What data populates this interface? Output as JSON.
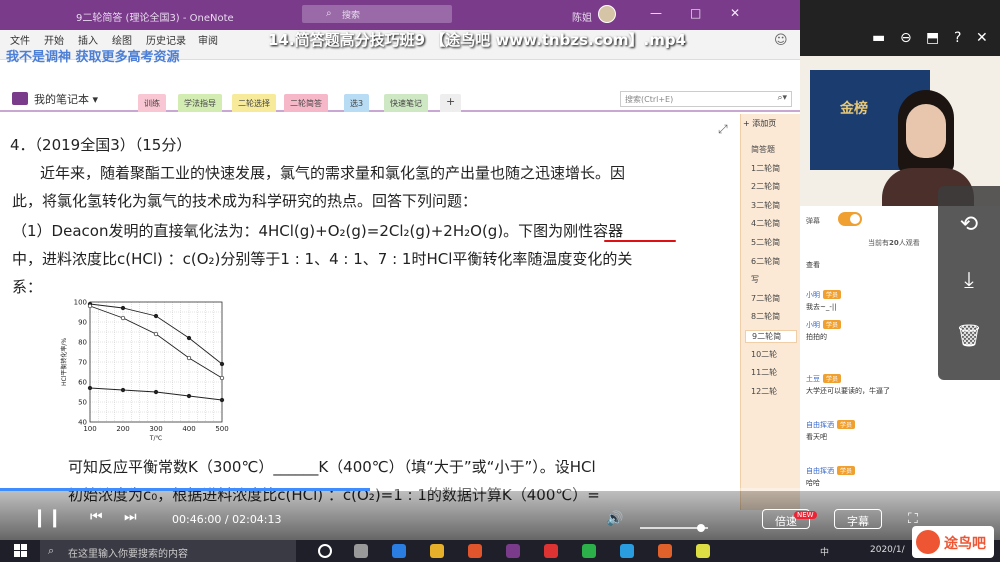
{
  "window": {
    "title": "9二轮简答 (理论全国3) - OneNote",
    "search_placeholder": "搜索",
    "user_name": "陈姐",
    "video_title": "14.简答题高分技巧班9 【途鸟吧 www.tnbzs.com】.mp4"
  },
  "ribbon": {
    "tabs": [
      "文件",
      "开始",
      "插入",
      "绘图",
      "历史记录",
      "审阅"
    ],
    "watermark": "我不是调神 获取更多高考资源"
  },
  "notebook": {
    "name": "我的笔记本",
    "sections": [
      {
        "label": "训练",
        "color": "#f9c7d4"
      },
      {
        "label": "学法指导",
        "color": "#d3ecb2"
      },
      {
        "label": "二轮选择",
        "color": "#f7ea9b"
      },
      {
        "label": "二轮简答",
        "color": "#f6b7c9"
      },
      {
        "label": "选3",
        "color": "#b7dcf4"
      },
      {
        "label": "快速笔记",
        "color": "#cfe8c4"
      }
    ],
    "add_section": "+",
    "search_placeholder": "搜索(Ctrl+E)"
  },
  "question": {
    "line1": "4．（2019全国3）（15分）",
    "line2": "近年来，随着聚酯工业的快速发展，氯气的需求量和氯化氢的产出量也随之迅速增长。因",
    "line3": "此，将氯化氢转化为氯气的技术成为科学研究的热点。回答下列问题：",
    "line4": "（1）Deacon发明的直接氧化法为：4HCl(g)+O₂(g)=2Cl₂(g)+2H₂O(g)。下图为刚性容器",
    "line5": "中，进料浓度比c(HCl) ：c(O₂)分别等于1 : 1、4 : 1、7 : 1时HCl平衡转化率随温度变化的关",
    "line6": "系：",
    "line7": "可知反应平衡常数K（300℃）______K（400℃）（填“大于”或“小于”）。设HCl",
    "line8": "初始浓度为c₀，根据进料浓度比c(HCl) ：c(O₂)=1 : 1的数据计算K（400℃）="
  },
  "chart_data": {
    "type": "line",
    "xlabel": "T/℃",
    "ylabel": "HCl平衡转化率/%",
    "x": [
      100,
      200,
      300,
      400,
      500
    ],
    "xlim": [
      100,
      500
    ],
    "ylim": [
      40,
      100
    ],
    "yticks": [
      40,
      50,
      60,
      70,
      80,
      90,
      100
    ],
    "grid": true,
    "series": [
      {
        "values": [
          99,
          97,
          93,
          82,
          69
        ],
        "marker": "circle"
      },
      {
        "values": [
          98,
          92,
          84,
          72,
          62
        ],
        "marker": "circle-open"
      },
      {
        "values": [
          57,
          56,
          55,
          53,
          51
        ],
        "marker": "circle"
      }
    ]
  },
  "pagelist": {
    "add_page": "+ 添加页",
    "pages": [
      "简答题",
      "1二轮简",
      "2二轮简",
      "3二轮简",
      "4二轮简",
      "5二轮简",
      "6二轮简",
      "写",
      "7二轮简",
      "8二轮简",
      "9二轮简",
      "10二轮",
      "11二轮",
      "12二轮"
    ],
    "active_index": 10
  },
  "live": {
    "poster_text": "金榜",
    "toggle_label": "弹幕",
    "online_prefix": "当前有",
    "online_count": "20",
    "online_suffix": "人观看",
    "chat": [
      {
        "name": "",
        "badge": "",
        "msg": "查看"
      },
      {
        "name": "小明",
        "badge": "学员",
        "msg": "我去~_-||"
      },
      {
        "name": "小明",
        "badge": "学员",
        "msg": "拍拍的"
      },
      {
        "name": "土豆",
        "badge": "学员",
        "msg": "大学还可以要读的，牛逼了"
      },
      {
        "name": "自由挥洒",
        "badge": "学员",
        "msg": "看天吧"
      },
      {
        "name": "自由挥洒",
        "badge": "学员",
        "msg": "哈哈"
      }
    ]
  },
  "player": {
    "current_time": "00:46:00",
    "total_time": "02:04:13",
    "progress": 0.37,
    "volume": 0.9,
    "speed_label": "倍速",
    "speed_badge": "NEW",
    "subtitle_label": "字幕"
  },
  "taskbar": {
    "search_placeholder": "在这里输入你要搜索的内容",
    "date": "2020/1/",
    "ime": "中",
    "logo": "途鸟吧"
  },
  "colors": {
    "onenote_purple": "#7a3b8a",
    "progress_blue": "#3f8cff",
    "taskbar": "#1f1f2a"
  }
}
